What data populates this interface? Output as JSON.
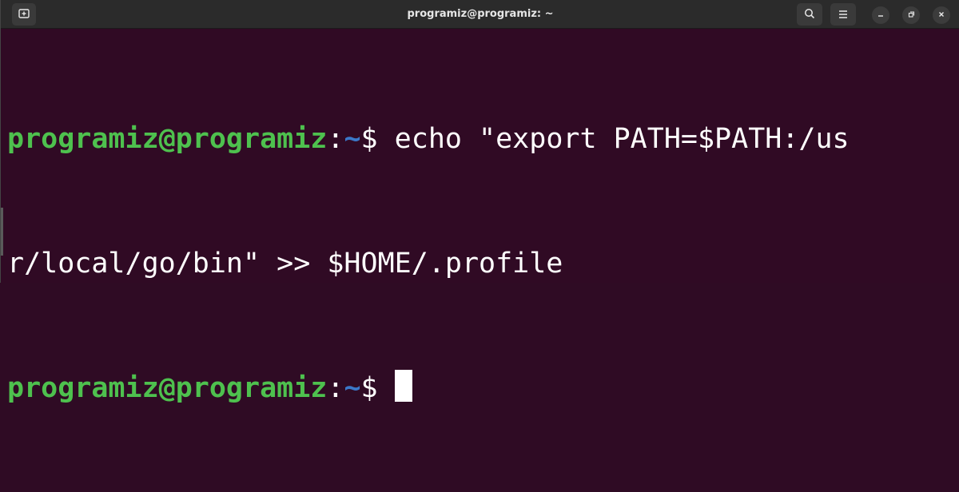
{
  "window": {
    "title": "programiz@programiz: ~"
  },
  "titlebar": {
    "new_tab_icon": "new-tab-icon",
    "search_icon": "search-icon",
    "menu_icon": "hamburger-menu-icon",
    "minimize_icon": "minimize-icon",
    "maximize_icon": "maximize-icon",
    "close_icon": "close-icon"
  },
  "terminal": {
    "lines": [
      {
        "user_host": "programiz@programiz",
        "colon": ":",
        "path": "~",
        "symbol": "$",
        "command_part1": " echo \"export PATH=$PATH:/us"
      },
      {
        "continuation": "r/local/go/bin\" >> $HOME/.profile"
      },
      {
        "user_host": "programiz@programiz",
        "colon": ":",
        "path": "~",
        "symbol": "$",
        "command": " "
      }
    ]
  },
  "colors": {
    "background": "#300a24",
    "prompt_user": "#4ec14e",
    "prompt_path": "#3b78c9",
    "text": "#ffffff"
  }
}
